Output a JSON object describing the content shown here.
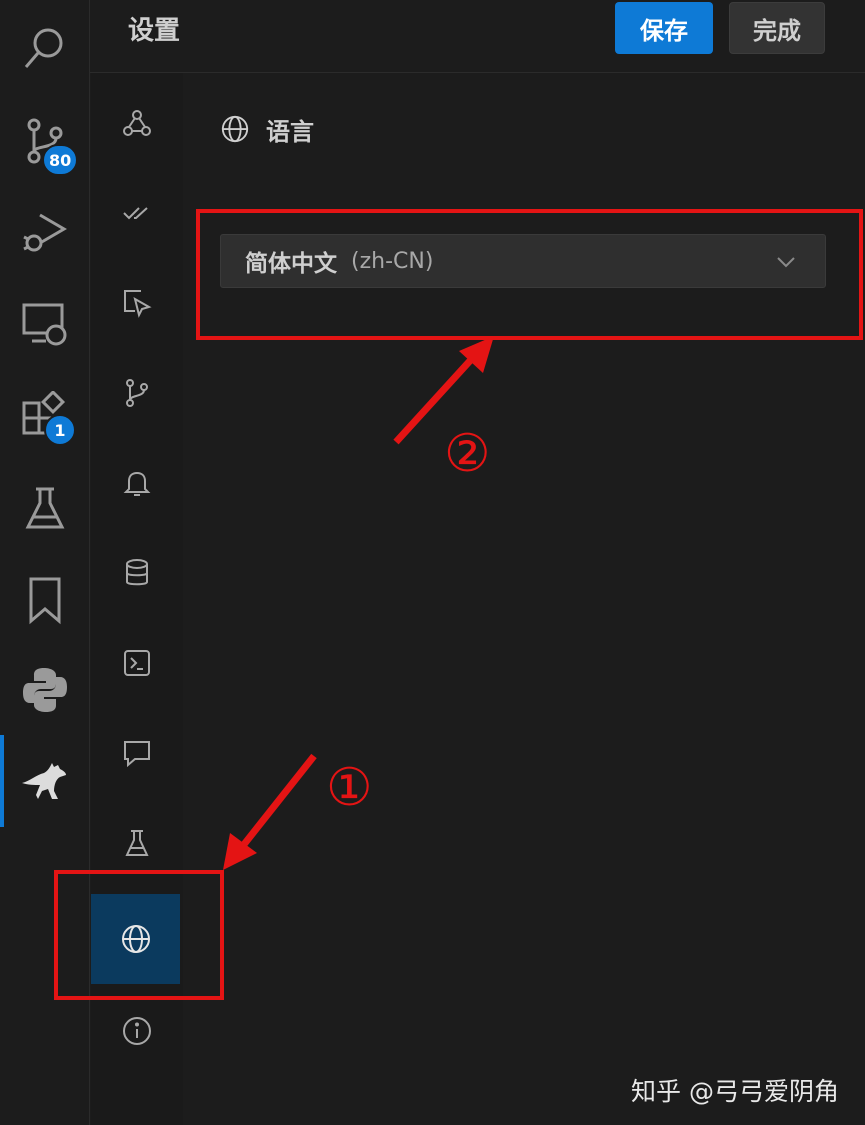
{
  "header": {
    "title": "设置",
    "save_label": "保存",
    "done_label": "完成"
  },
  "activity_bar": {
    "items": [
      {
        "icon": "search-icon"
      },
      {
        "icon": "source-control-icon",
        "badge": "80"
      },
      {
        "icon": "run-debug-icon"
      },
      {
        "icon": "remote-explorer-icon"
      },
      {
        "icon": "extensions-icon",
        "badge": "1"
      },
      {
        "icon": "testing-flask-icon"
      },
      {
        "icon": "bookmark-icon"
      },
      {
        "icon": "python-icon"
      },
      {
        "icon": "kangaroo-icon",
        "active": true
      }
    ]
  },
  "categories": [
    {
      "icon": "webhook-icon"
    },
    {
      "icon": "check-all-icon"
    },
    {
      "icon": "select-pointer-icon"
    },
    {
      "icon": "git-branch-icon"
    },
    {
      "icon": "bell-icon"
    },
    {
      "icon": "database-icon"
    },
    {
      "icon": "terminal-icon"
    },
    {
      "icon": "comment-icon"
    },
    {
      "icon": "beaker-icon"
    },
    {
      "icon": "globe-icon",
      "selected": true
    },
    {
      "icon": "info-icon"
    }
  ],
  "language_section": {
    "title": "语言",
    "selected_name": "简体中文",
    "selected_code": "(zh-CN)"
  },
  "annotations": {
    "step1": "①",
    "step2": "②"
  },
  "watermark": "知乎 @弓弓爱阴角",
  "colors": {
    "accent": "#0e7ad6",
    "annotation_red": "#e41414",
    "background": "#1c1c1c",
    "selected_category": "#0b3a5e"
  }
}
